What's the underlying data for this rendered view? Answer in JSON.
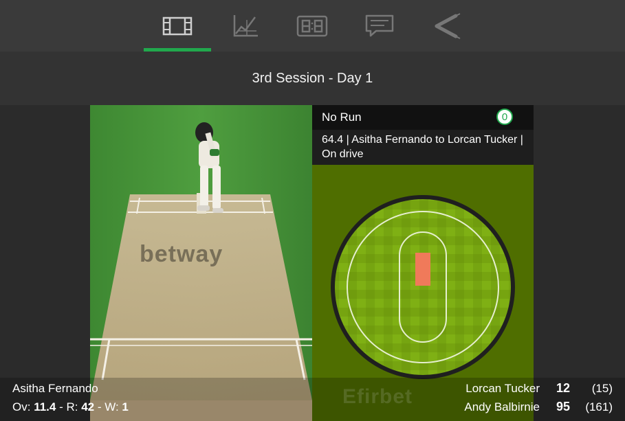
{
  "tabs": [
    {
      "name": "pitch-view-icon",
      "active": true
    },
    {
      "name": "chart-icon",
      "active": false
    },
    {
      "name": "scoreboard-icon",
      "active": false
    },
    {
      "name": "commentary-icon",
      "active": false
    },
    {
      "name": "cricket-bats-icon",
      "active": false
    }
  ],
  "session": {
    "title": "3rd Session - Day 1"
  },
  "event": {
    "result": "No Run",
    "runs": "0",
    "description": "64.4 | Asitha Fernando to Lorcan Tucker | On drive"
  },
  "pitch": {
    "branding": "betway"
  },
  "watermark": "Efirbet",
  "bowler": {
    "name": "Asitha Fernando",
    "ov_label": "Ov:",
    "overs": "11.4",
    "r_label": "R:",
    "runs": "42",
    "w_label": "W:",
    "wickets": "1"
  },
  "batsmen": [
    {
      "name": "Lorcan Tucker",
      "runs": "12",
      "balls": "(15)"
    },
    {
      "name": "Andy Balbirnie",
      "runs": "95",
      "balls": "(161)"
    }
  ],
  "colors": {
    "accent": "#21a84d",
    "field": "#4f6e00",
    "pitch_strip": "#f07a5a"
  }
}
